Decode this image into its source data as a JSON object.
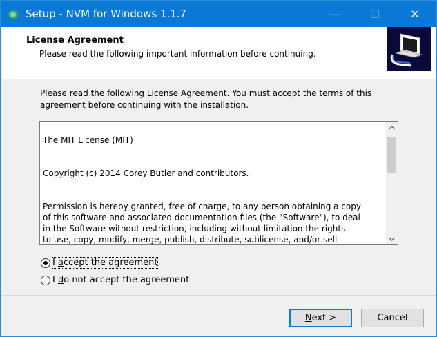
{
  "window": {
    "title": "Setup - NVM for Windows 1.1.7",
    "controls": {
      "minimize": "—",
      "maximize": "☐",
      "close": "✕"
    }
  },
  "header": {
    "title": "License Agreement",
    "subtitle": "Please read the following important information before continuing."
  },
  "intro_text": "Please read the following License Agreement. You must accept the terms of this agreement before continuing with the installation.",
  "license": {
    "paragraphs": [
      "The MIT License (MIT)",
      "Copyright (c) 2014 Corey Butler and contributors.",
      "Permission is hereby granted, free of charge, to any person obtaining a copy\nof this software and associated documentation files (the \"Software\"), to deal\nin the Software without restriction, including without limitation the rights\nto use, copy, modify, merge, publish, distribute, sublicense, and/or sell\ncopies of the Software, and to permit persons to whom the Software is\nfurnished to do so, subject to the following conditions:"
    ]
  },
  "options": {
    "accept": {
      "prefix": "I ",
      "underlined": "a",
      "rest": "ccept the agreement",
      "selected": true
    },
    "decline": {
      "prefix": "I ",
      "underlined": "d",
      "rest": "o not accept the agreement",
      "selected": false
    }
  },
  "buttons": {
    "next": {
      "underlined": "N",
      "rest": "ext >"
    },
    "cancel": "Cancel"
  },
  "colors": {
    "titlebar": "#0a78d7",
    "focus_border": "#0a78d7"
  }
}
